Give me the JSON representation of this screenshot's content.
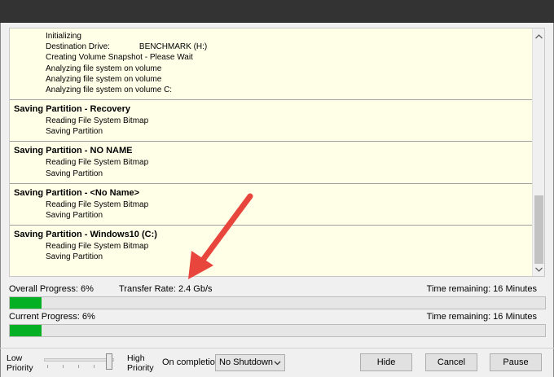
{
  "log": {
    "init_lines": [
      "Initializing",
      "Destination Drive:",
      "Creating Volume Snapshot - Please Wait",
      "Analyzing file system on volume",
      "Analyzing file system on volume",
      "Analyzing file system on volume C:"
    ],
    "destination_value": "BENCHMARK (H:)",
    "groups": [
      {
        "title": "Saving Partition - Recovery",
        "lines": [
          "Reading File System Bitmap",
          "Saving Partition"
        ]
      },
      {
        "title": "Saving Partition - NO NAME",
        "lines": [
          "Reading File System Bitmap",
          "Saving Partition"
        ]
      },
      {
        "title": "Saving Partition - <No Name>",
        "lines": [
          "Reading File System Bitmap",
          "Saving Partition"
        ]
      },
      {
        "title": "Saving Partition - Windows10 (C:)",
        "lines": [
          "Reading File System Bitmap",
          "Saving Partition"
        ]
      }
    ]
  },
  "overall": {
    "label": "Overall Progress:  6%",
    "transfer_rate": "Transfer Rate: 2.4 Gb/s",
    "time_remaining": "Time remaining: 16 Minutes",
    "progress": 0.06
  },
  "current": {
    "label": "Current Progress:  6%",
    "time_remaining": "Time remaining: 16 Minutes",
    "progress": 0.06
  },
  "priority": {
    "low_line1": "Low",
    "low_line2": "Priority",
    "high_line1": "High",
    "high_line2": "Priority",
    "level": 1.0
  },
  "on_completion": {
    "label": "On completion",
    "selected": "No Shutdown"
  },
  "buttons": {
    "hide": "Hide",
    "cancel": "Cancel",
    "pause": "Pause"
  },
  "colors": {
    "progress_fill": "#06b025",
    "log_background": "#ffffe8",
    "annotation_arrow": "#e8453c"
  },
  "icons": {
    "scroll_up": "chevron-up-icon",
    "scroll_down": "chevron-down-icon",
    "dropdown": "chevron-down-icon",
    "annotation": "red-arrow-annotation"
  }
}
